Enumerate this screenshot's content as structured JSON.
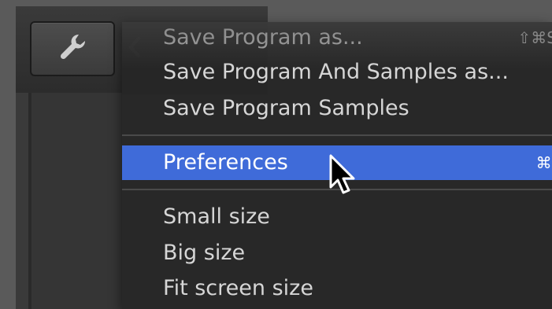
{
  "toolbar": {
    "wrench_icon": "wrench-icon",
    "back_icon": "chevron-left-icon"
  },
  "menu": {
    "highlight_color": "#3f6bd9",
    "items": [
      {
        "label": "Save Program as...",
        "shortcut": "⇧⌘S",
        "highlighted": false
      },
      {
        "label": "Save Program And Samples as...",
        "shortcut": "",
        "highlighted": false
      },
      {
        "label": "Save Program Samples",
        "shortcut": "",
        "highlighted": false
      },
      {
        "label": "Preferences",
        "shortcut": "⌘,",
        "highlighted": true
      },
      {
        "label": "Small size",
        "shortcut": "",
        "highlighted": false
      },
      {
        "label": "Big size",
        "shortcut": "",
        "highlighted": false
      },
      {
        "label": "Fit screen size",
        "shortcut": "",
        "highlighted": false
      }
    ]
  }
}
